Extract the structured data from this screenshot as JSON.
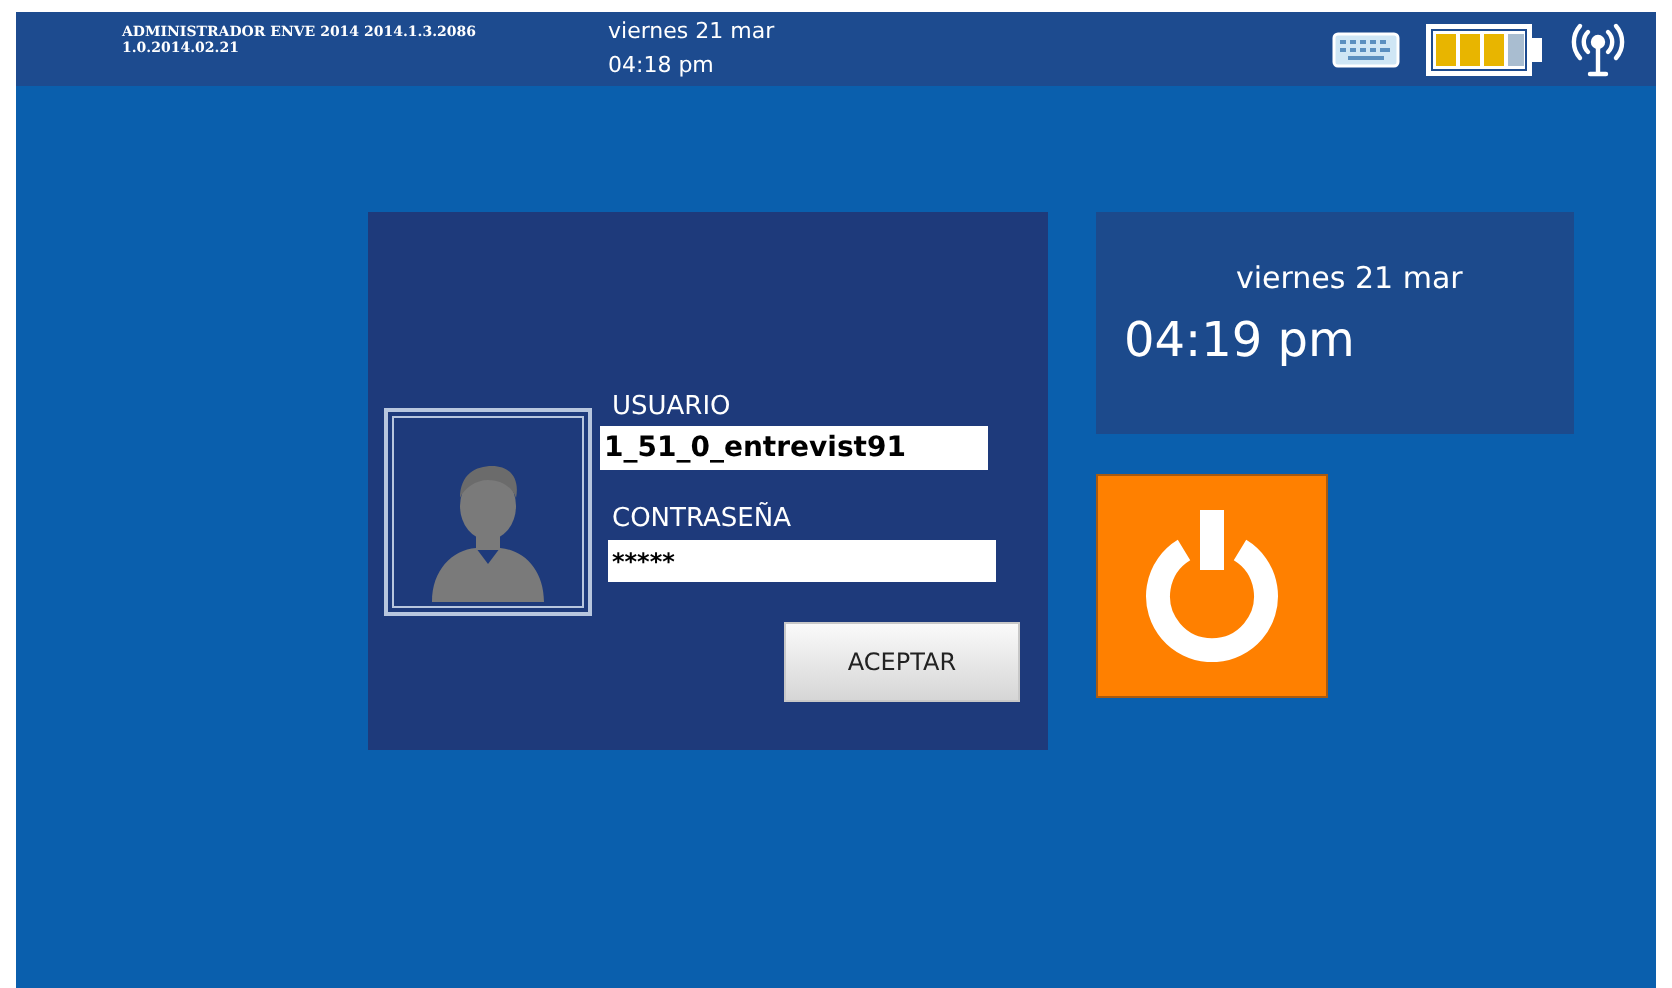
{
  "top_bar": {
    "app_title": "ADMINISTRADOR ENVE 2014 2014.1.3.2086",
    "version": "1.0.2014.02.21",
    "date": "viernes 21 mar",
    "time": "04:18 pm"
  },
  "login": {
    "user_label": "USUARIO",
    "user_value": "1_51_0_entrevist91",
    "password_label": "CONTRASEÑA",
    "password_value": "*****",
    "submit": "ACEPTAR"
  },
  "clock": {
    "date": "viernes 21 mar",
    "time": "04:19 pm"
  }
}
